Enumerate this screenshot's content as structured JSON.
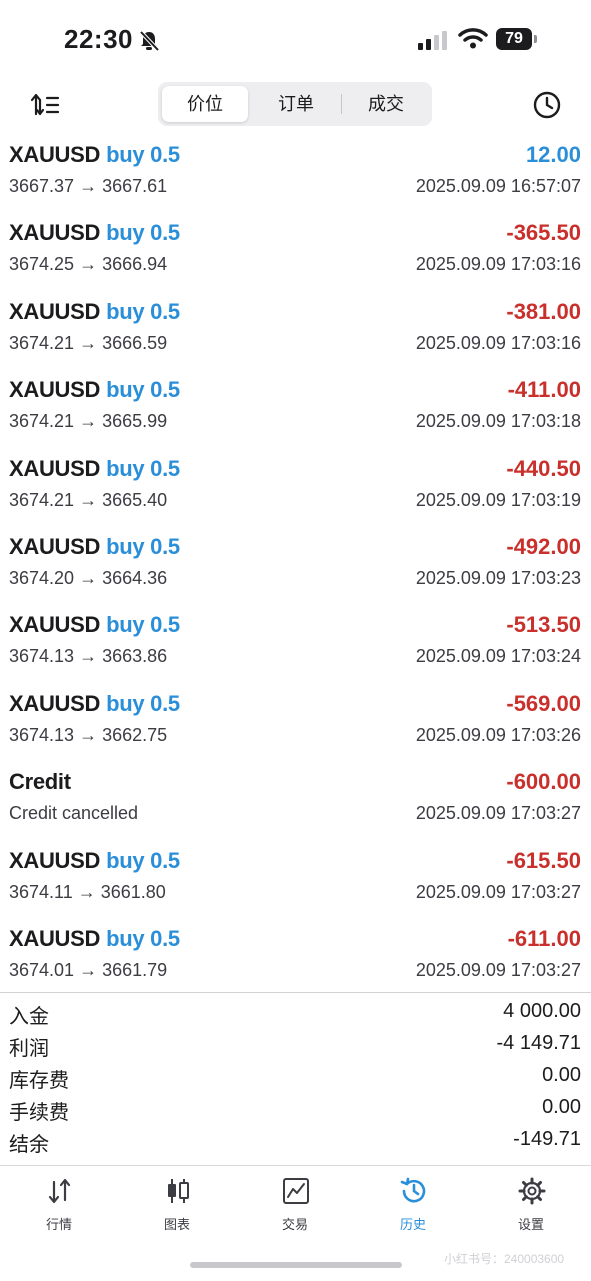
{
  "status_bar": {
    "time": "22:30",
    "battery": "79"
  },
  "toolbar": {
    "segments": [
      {
        "label": "价位",
        "active": true
      },
      {
        "label": "订单",
        "active": false
      },
      {
        "label": "成交",
        "active": false
      }
    ]
  },
  "deals": [
    {
      "symbol": "XAUUSD",
      "direction": "buy 0.5",
      "profit": "12.00",
      "sign": "pos",
      "prices": "3667.37 → 3667.61",
      "time": "2025.09.09 16:57:07"
    },
    {
      "symbol": "XAUUSD",
      "direction": "buy 0.5",
      "profit": "-365.50",
      "sign": "neg",
      "prices": "3674.25 → 3666.94",
      "time": "2025.09.09 17:03:16"
    },
    {
      "symbol": "XAUUSD",
      "direction": "buy 0.5",
      "profit": "-381.00",
      "sign": "neg",
      "prices": "3674.21 → 3666.59",
      "time": "2025.09.09 17:03:16"
    },
    {
      "symbol": "XAUUSD",
      "direction": "buy 0.5",
      "profit": "-411.00",
      "sign": "neg",
      "prices": "3674.21 → 3665.99",
      "time": "2025.09.09 17:03:18"
    },
    {
      "symbol": "XAUUSD",
      "direction": "buy 0.5",
      "profit": "-440.50",
      "sign": "neg",
      "prices": "3674.21 → 3665.40",
      "time": "2025.09.09 17:03:19"
    },
    {
      "symbol": "XAUUSD",
      "direction": "buy 0.5",
      "profit": "-492.00",
      "sign": "neg",
      "prices": "3674.20 → 3664.36",
      "time": "2025.09.09 17:03:23"
    },
    {
      "symbol": "XAUUSD",
      "direction": "buy 0.5",
      "profit": "-513.50",
      "sign": "neg",
      "prices": "3674.13 → 3663.86",
      "time": "2025.09.09 17:03:24"
    },
    {
      "symbol": "XAUUSD",
      "direction": "buy 0.5",
      "profit": "-569.00",
      "sign": "neg",
      "prices": "3674.13 → 3662.75",
      "time": "2025.09.09 17:03:26"
    },
    {
      "symbol": "Credit",
      "direction": "",
      "profit": "-600.00",
      "sign": "neg",
      "prices": "Credit cancelled",
      "time": "2025.09.09 17:03:27"
    },
    {
      "symbol": "XAUUSD",
      "direction": "buy 0.5",
      "profit": "-615.50",
      "sign": "neg",
      "prices": "3674.11 → 3661.80",
      "time": "2025.09.09 17:03:27"
    },
    {
      "symbol": "XAUUSD",
      "direction": "buy 0.5",
      "profit": "-611.00",
      "sign": "neg",
      "prices": "3674.01 → 3661.79",
      "time": "2025.09.09 17:03:27"
    }
  ],
  "summary": [
    {
      "label": "入金",
      "value": "4 000.00"
    },
    {
      "label": "利润",
      "value": "-4 149.71"
    },
    {
      "label": "库存费",
      "value": "0.00"
    },
    {
      "label": "手续费",
      "value": "0.00"
    },
    {
      "label": "结余",
      "value": "-149.71"
    }
  ],
  "tabbar": {
    "tabs": [
      {
        "label": "行情",
        "icon": "quotes-icon",
        "active": false
      },
      {
        "label": "图表",
        "icon": "chart-icon",
        "active": false
      },
      {
        "label": "交易",
        "icon": "trade-icon",
        "active": false
      },
      {
        "label": "历史",
        "icon": "history-icon",
        "active": true
      },
      {
        "label": "设置",
        "icon": "settings-icon",
        "active": false
      }
    ]
  },
  "watermark": "小红书号：240003600",
  "colors": {
    "accent": "#2a8fd8",
    "loss": "#c9302c",
    "text": "#1c1c1e"
  }
}
